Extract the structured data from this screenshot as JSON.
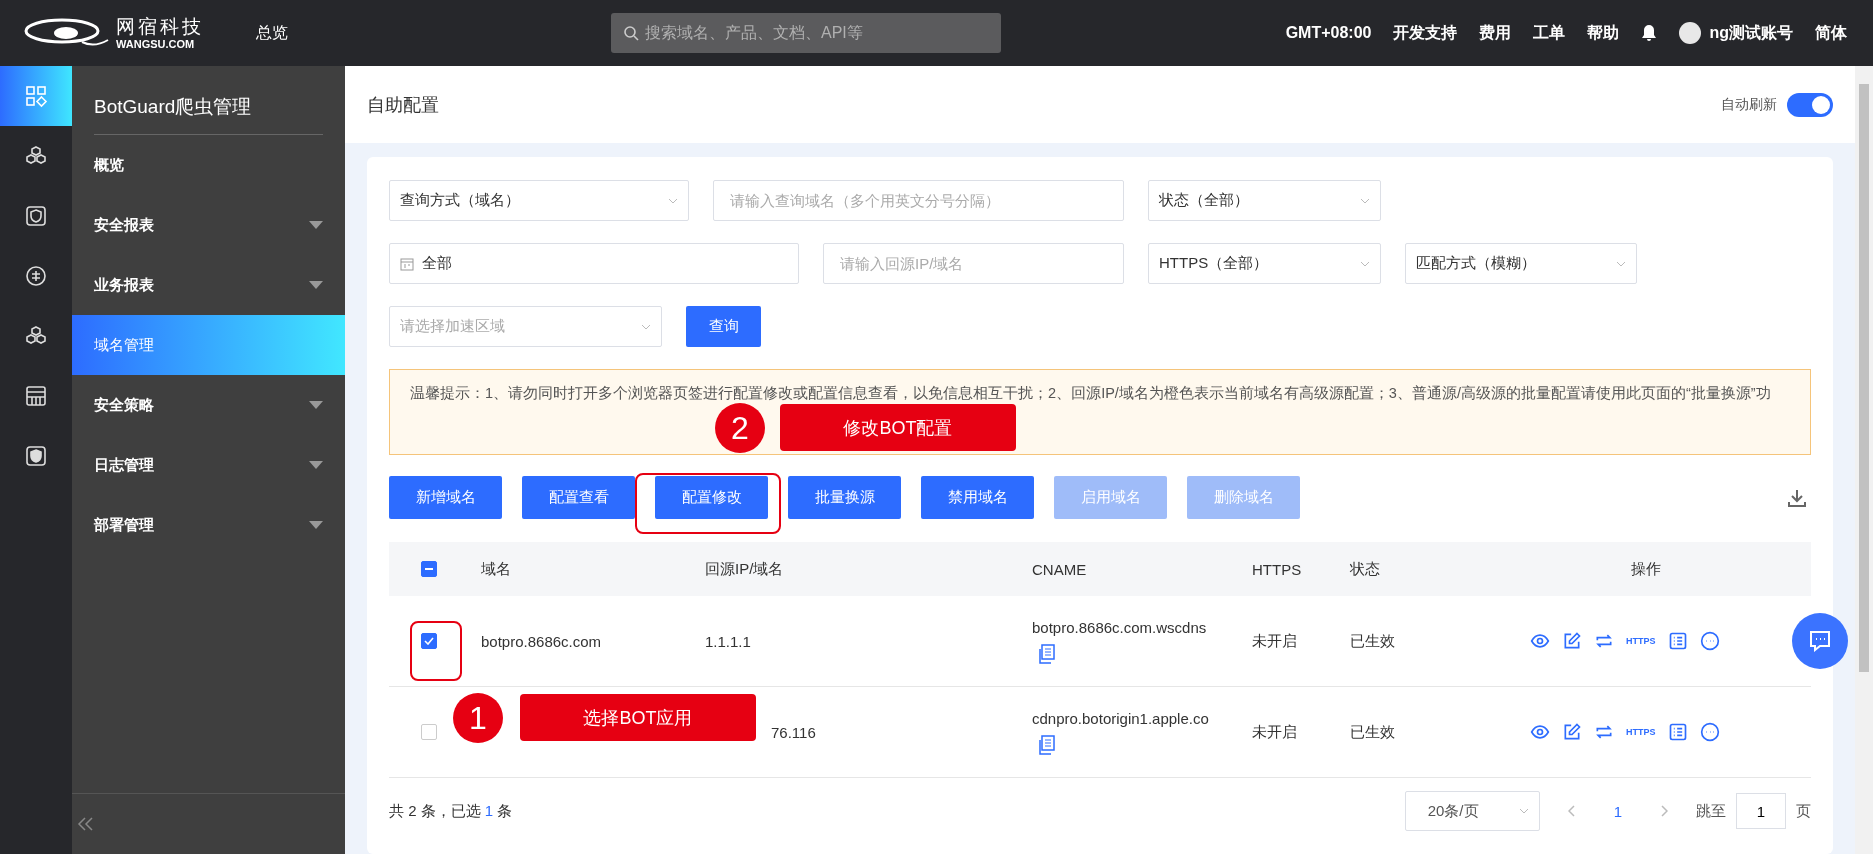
{
  "top_bar": {
    "brand_cn": "网宿科技",
    "brand_en": "WANGSU.COM",
    "nav": "总览",
    "search": {
      "placeholder": "搜索域名、产品、文档、API等"
    },
    "links": [
      "GMT+08:00",
      "开发支持",
      "费用",
      "工单",
      "帮助"
    ],
    "account": "ng测试账号",
    "language": "简体"
  },
  "icon_rail": [
    {
      "selected": true
    },
    {
      "selected": false
    },
    {
      "selected": false
    },
    {
      "selected": false
    },
    {
      "selected": false
    },
    {
      "selected": false
    },
    {
      "selected": false
    }
  ],
  "sidebar": {
    "title": "BotGuard爬虫管理",
    "items": [
      {
        "label": "概览",
        "expandable": false,
        "selected": false
      },
      {
        "label": "安全报表",
        "expandable": true,
        "selected": false
      },
      {
        "label": "业务报表",
        "expandable": true,
        "selected": false
      },
      {
        "label": "域名管理",
        "expandable": false,
        "selected": true
      },
      {
        "label": "安全策略",
        "expandable": true,
        "selected": false
      },
      {
        "label": "日志管理",
        "expandable": true,
        "selected": false
      },
      {
        "label": "部署管理",
        "expandable": true,
        "selected": false
      }
    ]
  },
  "page": {
    "title": "自助配置",
    "auto_refresh": {
      "label": "自动刷新",
      "on": true
    }
  },
  "filter_rows": [
    [
      {
        "kind": "select",
        "value": "查询方式（域名）"
      },
      {
        "kind": "input",
        "placeholder": "请输入查询域名（多个用英文分号分隔）"
      },
      {
        "kind": "select",
        "value": "状态（全部）"
      }
    ],
    [
      {
        "kind": "date",
        "value": "全部"
      },
      {
        "kind": "input",
        "placeholder": "请输入回源IP/域名"
      },
      {
        "kind": "select",
        "value": "HTTPS（全部）"
      },
      {
        "kind": "select",
        "value": "匹配方式（模糊）"
      }
    ],
    [
      {
        "kind": "select",
        "placeholder": "请选择加速区域"
      },
      {
        "kind": "button",
        "label": "查询"
      }
    ]
  ],
  "notice": "温馨提示：1、请勿同时打开多个浏览器页签进行配置修改或配置信息查看，以免信息相互干扰；2、回源IP/域名为橙色表示当前域名有高级源配置；3、普通源/高级源的批量配置请使用此页面的“批量换源”功",
  "actions": [
    {
      "label": "新增域名",
      "disabled": false
    },
    {
      "label": "配置查看",
      "disabled": false
    },
    {
      "label": "配置修改",
      "disabled": false
    },
    {
      "label": "批量换源",
      "disabled": false
    },
    {
      "label": "禁用域名",
      "disabled": false
    },
    {
      "label": "启用域名",
      "disabled": true
    },
    {
      "label": "删除域名",
      "disabled": true
    }
  ],
  "table": {
    "select_all_partial": true,
    "columns": [
      "域名",
      "回源IP/域名",
      "CNAME",
      "HTTPS",
      "状态",
      "操作"
    ],
    "rows": [
      {
        "checked": true,
        "domain": "botpro.8686c.com",
        "origin": "1.1.1.1",
        "cname": "botpro.8686c.com.wscdns",
        "https": "未开启",
        "status": "已生效",
        "https_action": "HTTPS"
      },
      {
        "checked": false,
        "origin": "76.116",
        "cname": "cdnpro.botorigin1.apple.co",
        "https": "未开启",
        "status": "已生效",
        "https_action": "HTTPS"
      }
    ]
  },
  "footer": {
    "summary_before": "共 2 条，已选",
    "selected_count": "1",
    "summary_after": "条",
    "page_size": "20条/页",
    "pages": [
      {
        "label": "1",
        "selected": true
      }
    ],
    "jump_label": "跳至",
    "jump_value": "1",
    "jump_unit": "页"
  },
  "annotations": [
    {
      "number": "2",
      "label": "修改BOT配置"
    },
    {
      "number": "1",
      "label": "选择BOT应用"
    }
  ]
}
